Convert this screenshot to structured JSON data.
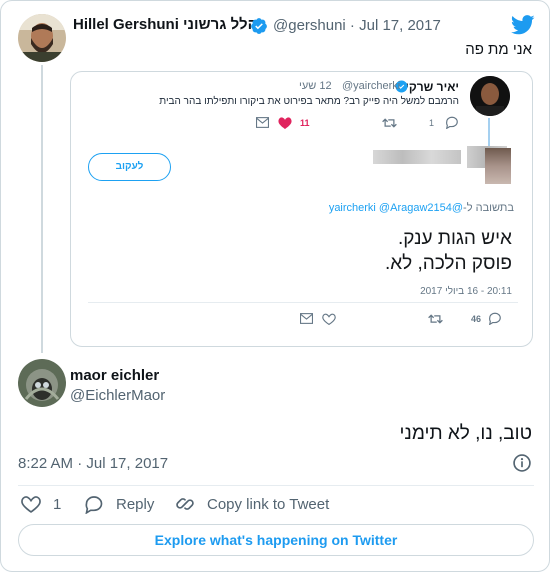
{
  "parent_tweet": {
    "display_name": "Hillel Gershuni הלל גרשוני",
    "handle_and_date": "@gershuni · Jul 17, 2017",
    "text": "אני מת פה"
  },
  "embedded_screenshot": {
    "name": "יאיר שרקי",
    "handle": "@yaircherki",
    "age": "12 שעי",
    "body": "הרמבם למשל היה פייק רב? מתאר בפירוט את ביקורו ותפילתו בהר הבית",
    "replies_count": "1",
    "likes_count": "11",
    "follow_label": "לעקוב",
    "reply_to_prefix": "בתשובה ל-",
    "reply_to_mentions": "@yaircherki @Aragaw2154",
    "big_text_line1": "איש הגות ענק.",
    "big_text_line2": "פוסק הלכה, לא.",
    "timestamp": "20:11 - 16 ביולי 2017",
    "reply_count_bottom": "46"
  },
  "main_tweet": {
    "display_name": "maor eichler",
    "handle": "@EichlerMaor",
    "text": "טוב, נו, לא תימני",
    "timestamp": "8:22 AM · Jul 17, 2017"
  },
  "actions": {
    "likes": "1",
    "reply_label": "Reply",
    "copy_label": "Copy link to Tweet"
  },
  "footer": {
    "explore_label": "Explore what's happening on Twitter"
  },
  "colors": {
    "accent": "#1d9bf0",
    "like_red": "#e0245e",
    "verified": "#1d9bf0"
  },
  "icons": [
    "twitter-bird-icon",
    "verified-badge-icon",
    "reply-icon",
    "retweet-icon",
    "heart-icon",
    "mail-icon",
    "info-icon",
    "copy-link-icon"
  ]
}
